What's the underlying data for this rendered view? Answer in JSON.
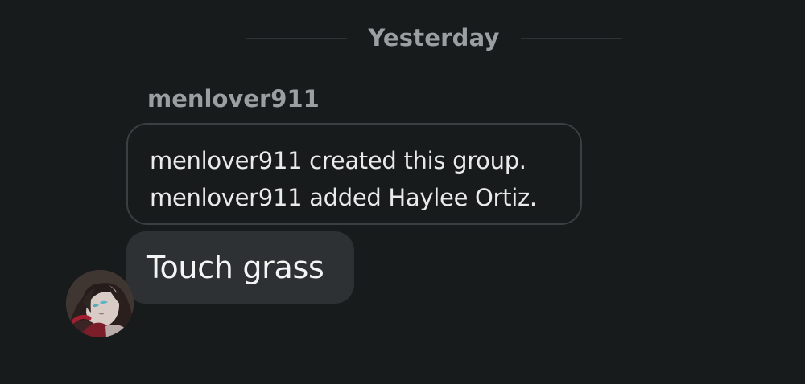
{
  "divider": {
    "date_label": "Yesterday"
  },
  "conversation": {
    "sender_name": "menlover911",
    "system_messages": [
      "menlover911 created this group.",
      "menlover911 added Haylee Ortiz."
    ],
    "message": {
      "text": "Touch grass"
    },
    "avatar": {
      "icon": "user-avatar-icon"
    }
  },
  "colors": {
    "background": "#181b1c",
    "bubble": "#2d3133",
    "system_border": "#3a3f41",
    "muted_text": "#9c9fa1",
    "primary_text": "#f3f4f4"
  }
}
